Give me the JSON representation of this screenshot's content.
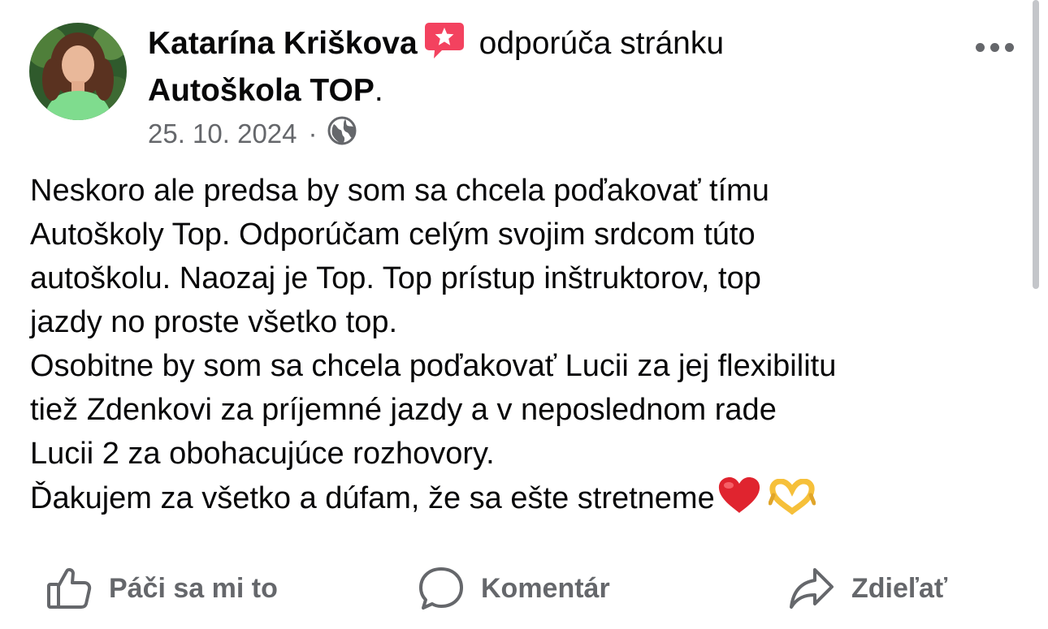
{
  "post": {
    "author_name": "Katarína Kriškova",
    "recommendation_icon": "recommend-star-icon",
    "action_text": "odporúča stránku",
    "page_name": "Autoškola TOP",
    "page_name_suffix": ".",
    "date": "25. 10. 2024",
    "separator": "·",
    "privacy_icon": "globe-icon",
    "more_icon": "more-options-icon",
    "body_lines": [
      "Neskoro ale predsa by som sa chcela poďakovať tímu",
      "Autoškoly Top. Odporúčam celým svojim srdcom túto",
      "autoškolu. Naozaj je Top. Top prístup inštruktorov, top",
      "jazdy no proste všetko top.",
      "Osobitne by som sa chcela poďakovať Lucii za jej flexibilitu",
      "tiež Zdenkovi za príjemné jazdy a v neposlednom rade",
      "Lucii 2 za obohacujúce rozhovory.",
      "Ďakujem za všetko a dúfam, že sa ešte stretneme"
    ],
    "body_emojis": [
      "heart-emoji",
      "heart-hands-emoji"
    ]
  },
  "actions": {
    "like_label": "Páči sa mi to",
    "comment_label": "Komentár",
    "share_label": "Zdieľať"
  },
  "colors": {
    "text_primary": "#080809",
    "text_secondary": "#65676b",
    "recommend_badge": "#f3425f",
    "heart": "#e0242f",
    "heart_hands": "#f6c03a"
  }
}
